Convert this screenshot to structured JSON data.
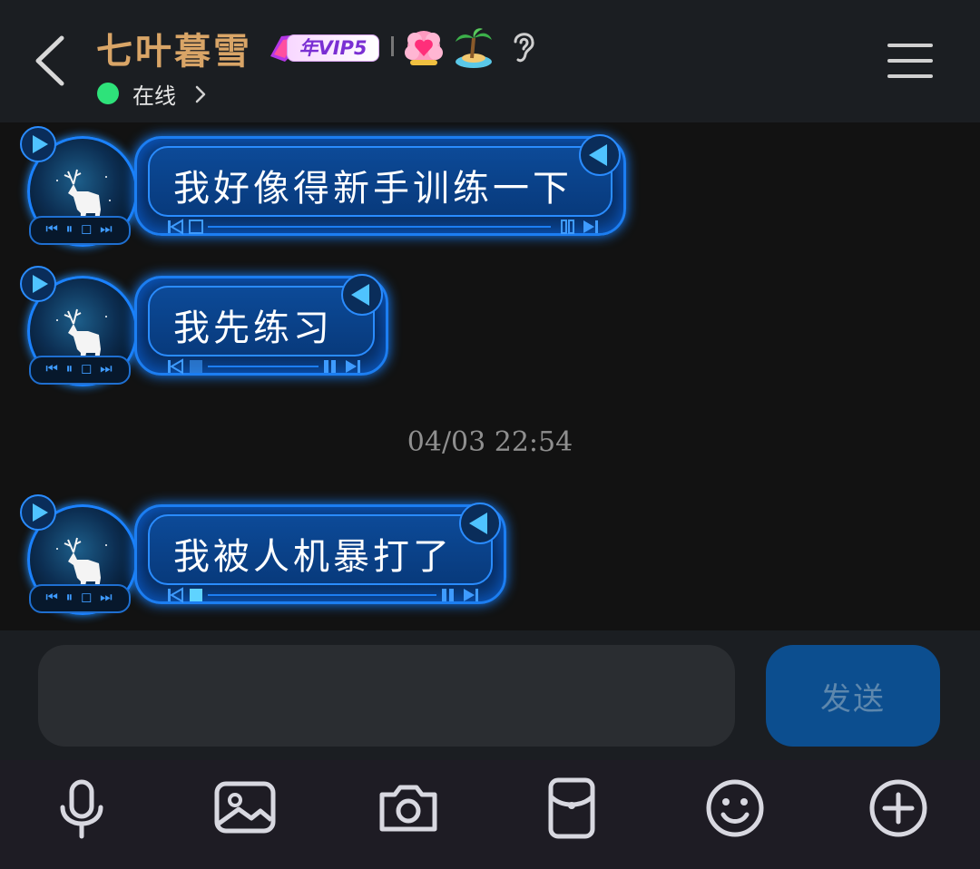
{
  "header": {
    "contact_name": "七叶暮雪",
    "vip_label": "年VIP5",
    "status": "在线"
  },
  "messages": [
    {
      "text": "我好像得新手训练一下"
    },
    {
      "text": "我先练习"
    },
    {
      "text": "我被人机暴打了"
    }
  ],
  "timestamp": "04/03 22:54",
  "input": {
    "placeholder": "",
    "send_label": "发送"
  },
  "toolbar": {
    "icons": [
      "microphone-icon",
      "image-icon",
      "camera-icon",
      "red-packet-icon",
      "emoji-icon",
      "plus-icon"
    ]
  },
  "colors": {
    "title": "#d9a567",
    "online": "#2ee27a",
    "bubble_border": "#1c7ef2",
    "send_button": "#0c4e8f"
  }
}
